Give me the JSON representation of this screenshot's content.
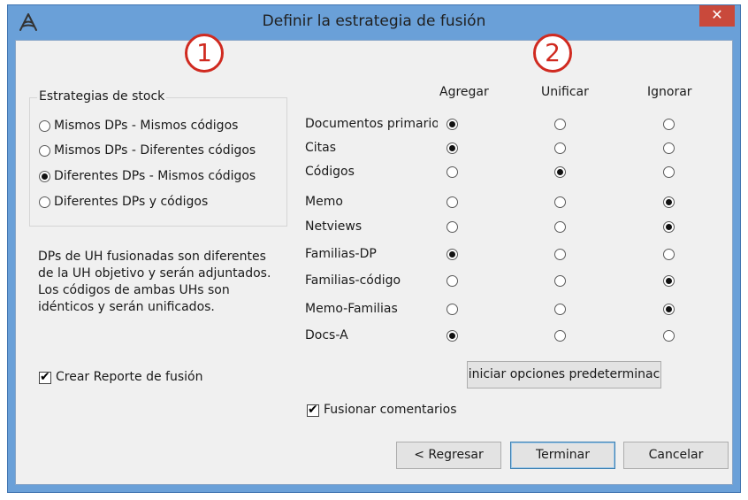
{
  "window": {
    "title": "Definir la estrategia de fusión",
    "close_label": "✕",
    "app_icon": "atlas-ti-icon"
  },
  "badges": [
    "1",
    "2"
  ],
  "stock_group": {
    "title": "Estrategias de stock",
    "options": [
      {
        "label": "Mismos DPs - Mismos códigos",
        "selected": false
      },
      {
        "label": "Mismos DPs - Diferentes códigos",
        "selected": false
      },
      {
        "label": "Diferentes DPs - Mismos códigos",
        "selected": true
      },
      {
        "label": "Diferentes DPs y códigos",
        "selected": false
      }
    ]
  },
  "description": [
    "DPs de UH fusionadas son diferentes",
    "de la UH objetivo y serán adjuntados.",
    "Los códigos de ambas UHs son",
    "idénticos y serán unificados."
  ],
  "report_checkbox": {
    "label": "Crear Reporte de fusión",
    "checked": true
  },
  "matrix": {
    "columns": [
      "Agregar",
      "Unificar",
      "Ignorar"
    ],
    "rows": [
      {
        "label": "Documentos primarios",
        "choice": 0
      },
      {
        "label": "Citas",
        "choice": 0
      },
      {
        "label": "Códigos",
        "choice": 1
      },
      {
        "label": "Memo",
        "choice": 2
      },
      {
        "label": "Netviews",
        "choice": 2
      },
      {
        "label": "Familias-DP",
        "choice": 0
      },
      {
        "label": "Familias-código",
        "choice": 2
      },
      {
        "label": "Memo-Familias",
        "choice": 2
      },
      {
        "label": "Docs-A",
        "choice": 0
      }
    ]
  },
  "reset_button": "iniciar opciones predeterminac",
  "comments_checkbox": {
    "label": "Fusionar comentarios",
    "checked": true
  },
  "footer": {
    "back": "< Regresar",
    "finish": "Terminar",
    "cancel": "Cancelar"
  },
  "colors": {
    "title_bar": "#6aa0d8",
    "close": "#c9493b",
    "badge": "#d02a20",
    "client": "#f0f0f0"
  }
}
